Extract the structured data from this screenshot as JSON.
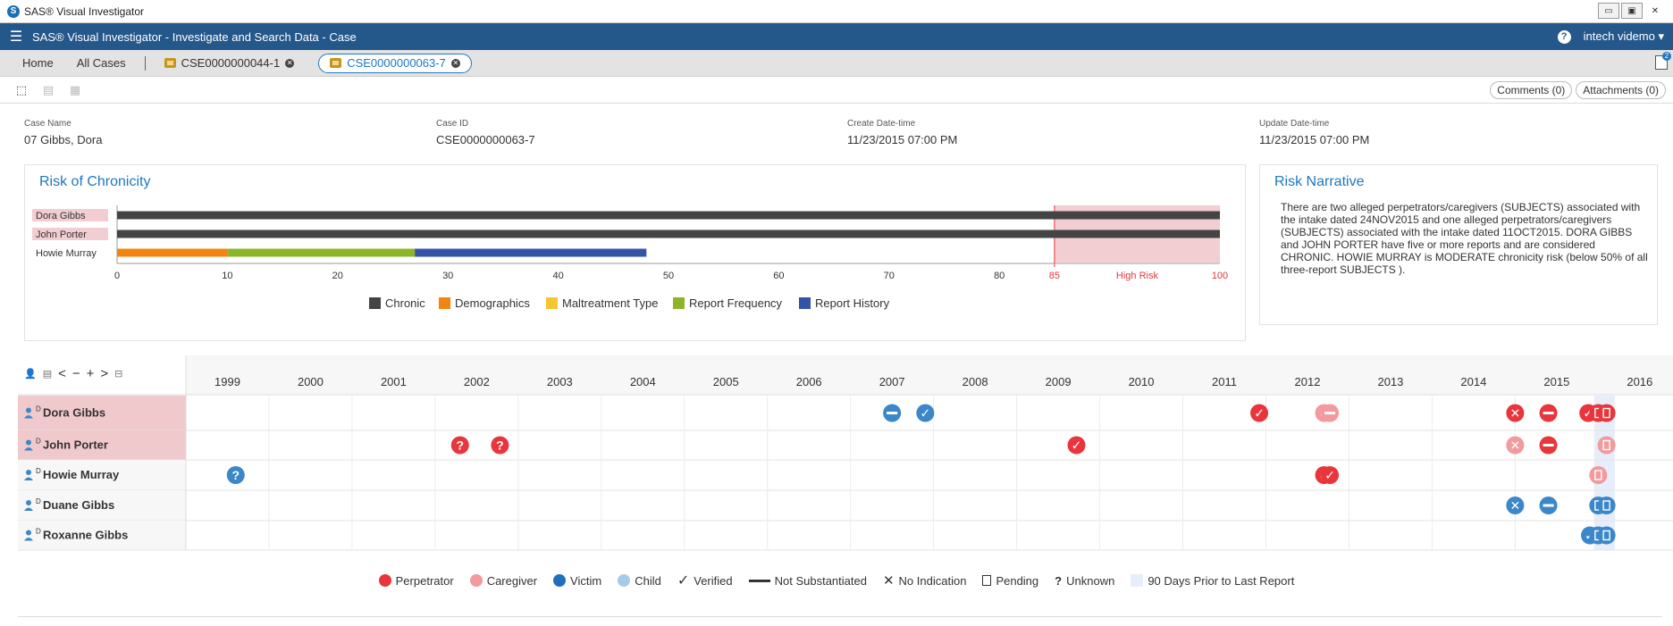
{
  "window": {
    "title": "SAS® Visual Investigator",
    "logo": "S",
    "controls": [
      "minimize-icon",
      "restore-icon",
      "close-icon"
    ]
  },
  "appbar": {
    "title": "SAS® Visual Investigator - Investigate and Search Data - Case",
    "user": "intech videmo",
    "help": "?"
  },
  "tabs": {
    "home": "Home",
    "all_cases": "All Cases",
    "case1": "CSE0000000044-1",
    "case2": "CSE0000000063-7"
  },
  "notifications": {
    "count": "2"
  },
  "toolbar": {
    "comments": "Comments (0)",
    "attachments": "Attachments (0)"
  },
  "case": {
    "name_label": "Case Name",
    "name": "07 Gibbs, Dora",
    "id_label": "Case ID",
    "id": "CSE0000000063-7",
    "created_label": "Create Date-time",
    "created": "11/23/2015 07:00 PM",
    "updated_label": "Update Date-time",
    "updated": "11/23/2015 07:00 PM"
  },
  "risk_panel": {
    "title": "Risk of Chronicity"
  },
  "narrative": {
    "title": "Risk Narrative",
    "text": "There are two alleged perpetrators/caregivers (SUBJECTS) associated with the intake dated 24NOV2015 and one alleged perpetrators/caregivers (SUBJECTS) associated with the intake dated 11OCT2015. DORA GIBBS and JOHN PORTER have five or more reports and are considered CHRONIC. HOWIE MURRAY is MODERATE chronicity risk (below 50% of all three-report SUBJECTS )."
  },
  "chart_data": {
    "type": "bar",
    "orientation": "horizontal",
    "stacked": true,
    "categories": [
      "Dora Gibbs",
      "John Porter",
      "Howie Murray"
    ],
    "highlighted_categories": [
      "Dora Gibbs",
      "John Porter"
    ],
    "xlim": [
      0,
      100
    ],
    "ticks": [
      "0",
      "10",
      "20",
      "30",
      "40",
      "50",
      "60",
      "70",
      "80",
      "85",
      "High Risk",
      "100"
    ],
    "tick_values": [
      0,
      10,
      20,
      30,
      40,
      50,
      60,
      70,
      80,
      85,
      92.5,
      100
    ],
    "high_risk_threshold": 85,
    "series": [
      {
        "name": "Chronic",
        "color": "#444444",
        "values": [
          100,
          100,
          0
        ]
      },
      {
        "name": "Demographics",
        "color": "#f28411",
        "values": [
          0,
          0,
          10
        ]
      },
      {
        "name": "Maltreatment Type",
        "color": "#f7c432",
        "values": [
          0,
          0,
          0
        ]
      },
      {
        "name": "Report Frequency",
        "color": "#8db52a",
        "values": [
          0,
          0,
          17
        ]
      },
      {
        "name": "Report History",
        "color": "#3553a6",
        "values": [
          0,
          0,
          21
        ]
      }
    ],
    "legend_position": "bottom"
  },
  "timeline": {
    "years": [
      "1999",
      "2000",
      "2001",
      "2002",
      "2003",
      "2004",
      "2005",
      "2006",
      "2007",
      "2008",
      "2009",
      "2010",
      "2011",
      "2012",
      "2013",
      "2014",
      "2015",
      "2016"
    ],
    "start_year": 1998.5,
    "end_year": 2016.4,
    "window_90_days": [
      2015.45,
      2015.7
    ],
    "subjects": [
      {
        "name": "Dora Gibbs",
        "sup": "D",
        "highlight": true
      },
      {
        "name": "John Porter",
        "sup": "D",
        "highlight": true
      },
      {
        "name": "Howie Murray",
        "sup": "D",
        "highlight": false
      },
      {
        "name": "Duane Gibbs",
        "sup": "D",
        "highlight": false
      },
      {
        "name": "Roxanne Gibbs",
        "sup": "D",
        "highlight": false
      }
    ],
    "events": [
      {
        "row": 0,
        "t": 2007.0,
        "role": "victim",
        "status": "not_substantiated"
      },
      {
        "row": 0,
        "t": 2007.4,
        "role": "victim",
        "status": "verified"
      },
      {
        "row": 0,
        "t": 2011.42,
        "role": "perpetrator",
        "status": "verified"
      },
      {
        "row": 0,
        "t": 2012.2,
        "role": "caregiver",
        "status": "verified"
      },
      {
        "row": 0,
        "t": 2012.27,
        "role": "caregiver",
        "status": "not_substantiated"
      },
      {
        "row": 0,
        "t": 2014.5,
        "role": "perpetrator",
        "status": "no_indication"
      },
      {
        "row": 0,
        "t": 2014.9,
        "role": "perpetrator",
        "status": "not_substantiated"
      },
      {
        "row": 0,
        "t": 2015.38,
        "role": "perpetrator",
        "status": "verified"
      },
      {
        "row": 0,
        "t": 2015.5,
        "role": "perpetrator",
        "status": "pending"
      },
      {
        "row": 0,
        "t": 2015.6,
        "role": "perpetrator",
        "status": "pending"
      },
      {
        "row": 1,
        "t": 2001.8,
        "role": "perpetrator",
        "status": "unknown"
      },
      {
        "row": 1,
        "t": 2002.28,
        "role": "perpetrator",
        "status": "unknown"
      },
      {
        "row": 1,
        "t": 2009.22,
        "role": "perpetrator",
        "status": "verified"
      },
      {
        "row": 1,
        "t": 2014.5,
        "role": "caregiver",
        "status": "no_indication"
      },
      {
        "row": 1,
        "t": 2014.9,
        "role": "perpetrator",
        "status": "not_substantiated"
      },
      {
        "row": 1,
        "t": 2015.6,
        "role": "caregiver",
        "status": "pending"
      },
      {
        "row": 2,
        "t": 1999.1,
        "role": "victim",
        "status": "unknown"
      },
      {
        "row": 2,
        "t": 2012.2,
        "role": "perpetrator",
        "status": "verified"
      },
      {
        "row": 2,
        "t": 2012.27,
        "role": "perpetrator",
        "status": "verified"
      },
      {
        "row": 2,
        "t": 2015.5,
        "role": "caregiver",
        "status": "pending"
      },
      {
        "row": 3,
        "t": 2014.5,
        "role": "victim",
        "status": "no_indication"
      },
      {
        "row": 3,
        "t": 2014.9,
        "role": "victim",
        "status": "not_substantiated"
      },
      {
        "row": 3,
        "t": 2015.5,
        "role": "victim",
        "status": "pending"
      },
      {
        "row": 3,
        "t": 2015.6,
        "role": "victim",
        "status": "pending"
      },
      {
        "row": 4,
        "t": 2015.4,
        "role": "victim",
        "status": "verified"
      },
      {
        "row": 4,
        "t": 2015.5,
        "role": "victim",
        "status": "pending"
      },
      {
        "row": 4,
        "t": 2015.6,
        "role": "victim",
        "status": "pending"
      }
    ]
  },
  "legend": {
    "perpetrator": "Perpetrator",
    "caregiver": "Caregiver",
    "victim": "Victim",
    "child": "Child",
    "verified": "Verified",
    "not_substantiated": "Not Substantiated",
    "no_indication": "No Indication",
    "pending": "Pending",
    "unknown": "Unknown",
    "window": "90 Days Prior to Last Report"
  },
  "colors": {
    "perpetrator": "#e8363c",
    "caregiver": "#f29a9e",
    "victim": "#3b87c9",
    "child": "#9cc7ea",
    "highlight": "#f0c9cd",
    "window": "#e7eefb",
    "accent": "#1f77c0"
  }
}
